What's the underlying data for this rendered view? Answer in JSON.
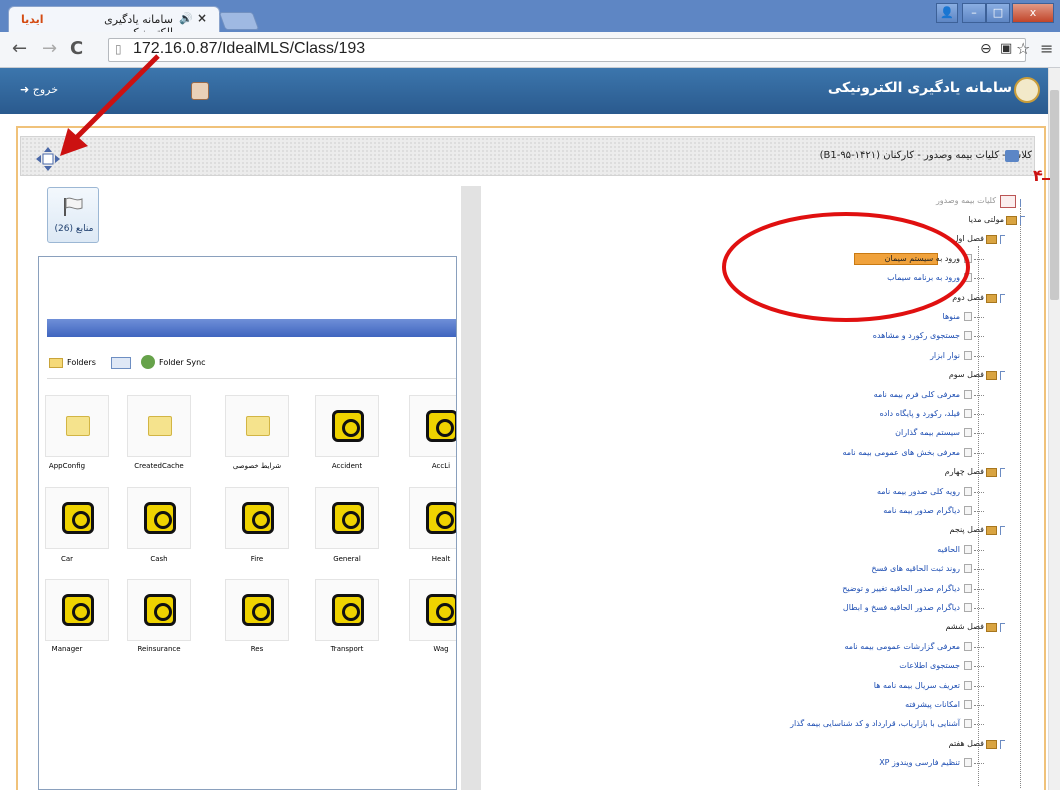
{
  "browser": {
    "tab_title": "سامانه یادگیری الکترونیکی",
    "tab_logo": "ایدیا",
    "url": "172.16.0.87/IdealMLS/Class/193"
  },
  "app": {
    "brand": "سامانه یادگیری الکترونیکی",
    "logout_label": "خروج"
  },
  "breadcrumb": "کلاس - کلیات بیمه وصدور - کارکنان (۱۴۲۱-۹۵-B1)",
  "annotation_marker": "۴",
  "resource_button": {
    "label": "منابع (26)"
  },
  "viewer": {
    "toolbar": [
      "Folders",
      "Folder Sync"
    ],
    "rows": [
      [
        "AppConfig",
        "CreatedCache",
        "شرایط خصوصی",
        "Accident",
        "AccLi"
      ],
      [
        "Car",
        "Cash",
        "Fire",
        "General",
        "Healt"
      ],
      [
        "Manager",
        "Reinsurance",
        "Res",
        "Transport",
        "Wag"
      ]
    ]
  },
  "tree": {
    "root": "کلیات بیمه وصدور",
    "items": [
      {
        "label": "مولتی مدیا",
        "type": "folder",
        "level": 1
      },
      {
        "label": "فصل اول",
        "type": "folder",
        "level": 2
      },
      {
        "label": "ورود به سیستم سیمان",
        "type": "doc",
        "level": 3,
        "selected": true
      },
      {
        "label": "ورود به برنامه سیماب",
        "type": "doc",
        "level": 3
      },
      {
        "label": "فصل دوم",
        "type": "folder",
        "level": 2
      },
      {
        "label": "منوها",
        "type": "doc",
        "level": 3
      },
      {
        "label": "جستجوی رکورد و مشاهده",
        "type": "doc",
        "level": 3
      },
      {
        "label": "نوار ابزار",
        "type": "doc",
        "level": 3
      },
      {
        "label": "فصل سوم",
        "type": "folder",
        "level": 2
      },
      {
        "label": "معرفی کلی فرم بیمه نامه",
        "type": "doc",
        "level": 3
      },
      {
        "label": "فیلد، رکورد و پایگاه داده",
        "type": "doc",
        "level": 3
      },
      {
        "label": "سیستم بیمه گذاران",
        "type": "doc",
        "level": 3
      },
      {
        "label": "معرفی بخش های عمومی بیمه نامه",
        "type": "doc",
        "level": 3
      },
      {
        "label": "فصل چهارم",
        "type": "folder",
        "level": 2
      },
      {
        "label": "رویه کلی صدور بیمه نامه",
        "type": "doc",
        "level": 3
      },
      {
        "label": "دیاگرام صدور بیمه نامه",
        "type": "doc",
        "level": 3
      },
      {
        "label": "فصل پنجم",
        "type": "folder",
        "level": 2
      },
      {
        "label": "الحاقیه",
        "type": "doc",
        "level": 3
      },
      {
        "label": "روند ثبت الحاقیه های فسخ",
        "type": "doc",
        "level": 3
      },
      {
        "label": "دیاگرام صدور الحاقیه تغییر و توضیح",
        "type": "doc",
        "level": 3
      },
      {
        "label": "دیاگرام صدور الحاقیه فسخ و ابطال",
        "type": "doc",
        "level": 3
      },
      {
        "label": "فصل ششم",
        "type": "folder",
        "level": 2
      },
      {
        "label": "معرفی گزارشات عمومی بیمه نامه",
        "type": "doc",
        "level": 3
      },
      {
        "label": "جستجوی اطلاعات",
        "type": "doc",
        "level": 3
      },
      {
        "label": "تعریف سریال بیمه نامه ها",
        "type": "doc",
        "level": 3
      },
      {
        "label": "امکانات پیشرفته",
        "type": "doc",
        "level": 3
      },
      {
        "label": "آشنایی با بازاریاب، قرارداد و کد شناسایی بیمه گذار",
        "type": "doc",
        "level": 3
      },
      {
        "label": "فصل هفتم",
        "type": "folder",
        "level": 2
      },
      {
        "label": "تنظیم فارسی ویندوز XP",
        "type": "doc",
        "level": 3
      }
    ]
  },
  "colors": {
    "annotation": "#e01010",
    "header": "#2f6399",
    "frame": "#f0c27a",
    "link": "#1f4fb3"
  }
}
